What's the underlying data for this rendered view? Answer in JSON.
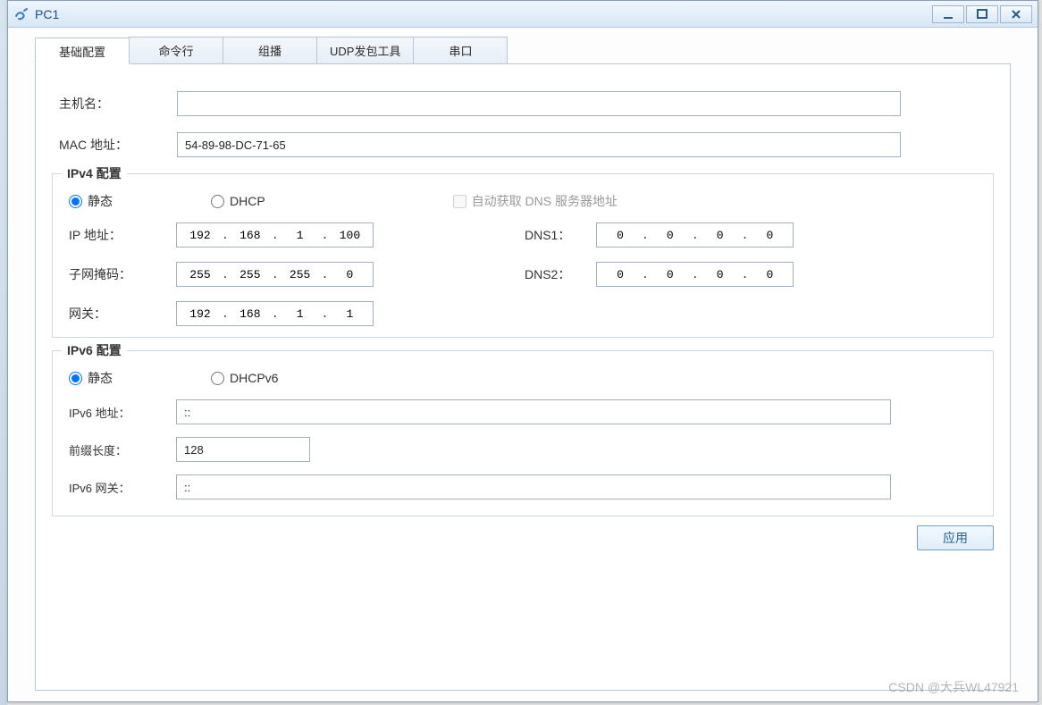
{
  "window": {
    "title": "PC1"
  },
  "tabs": {
    "basic": "基础配置",
    "cmd": "命令行",
    "multicast": "组播",
    "udp": "UDP发包工具",
    "serial": "串口"
  },
  "labels": {
    "hostname": "主机名：",
    "mac": "MAC 地址：",
    "ipv4_section": "IPv4 配置",
    "ipv6_section": "IPv6 配置",
    "static": "静态",
    "dhcp": "DHCP",
    "dhcpv6": "DHCPv6",
    "auto_dns": "自动获取 DNS 服务器地址",
    "ip": "IP 地址：",
    "mask": "子网掩码：",
    "gateway": "网关：",
    "dns1": "DNS1：",
    "dns2": "DNS2：",
    "ipv6_addr": "IPv6 地址：",
    "prefix_len": "前缀长度：",
    "ipv6_gw": "IPv6 网关：",
    "apply": "应用"
  },
  "values": {
    "hostname": "",
    "mac": "54-89-98-DC-71-65",
    "ipv4": {
      "mode_static": true,
      "mode_dhcp": false,
      "auto_dns": false,
      "ip": [
        "192",
        "168",
        "1",
        "100"
      ],
      "mask": [
        "255",
        "255",
        "255",
        "0"
      ],
      "gateway": [
        "192",
        "168",
        "1",
        "1"
      ],
      "dns1": [
        "0",
        "0",
        "0",
        "0"
      ],
      "dns2": [
        "0",
        "0",
        "0",
        "0"
      ]
    },
    "ipv6": {
      "mode_static": true,
      "mode_dhcp": false,
      "addr": "::",
      "prefix": "128",
      "gateway": "::"
    }
  },
  "watermark": "CSDN @大兵WL47921"
}
